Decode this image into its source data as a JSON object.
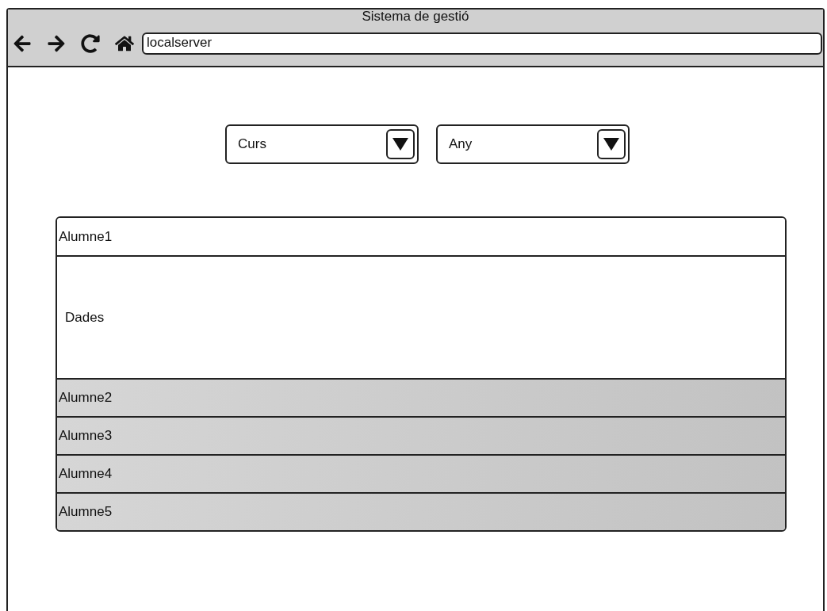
{
  "window": {
    "title": "Sistema de gestió",
    "address": "localserver"
  },
  "filters": [
    {
      "value": "Curs"
    },
    {
      "value": "Any"
    }
  ],
  "students": [
    {
      "name": "Alumne1",
      "expanded": true,
      "content": "Dades"
    },
    {
      "name": "Alumne2",
      "expanded": false
    },
    {
      "name": "Alumne3",
      "expanded": false
    },
    {
      "name": "Alumne4",
      "expanded": false
    },
    {
      "name": "Alumne5",
      "expanded": false
    }
  ]
}
